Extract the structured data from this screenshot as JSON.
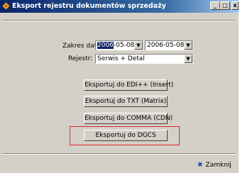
{
  "window": {
    "title": "Eksport rejestru dokumentów sprzedaży"
  },
  "titlebar_buttons": {
    "minimize": "_",
    "maximize": "□",
    "close": "x"
  },
  "form": {
    "date_range_label": "Zakres dat:",
    "date_from": {
      "selected": "2006",
      "rest": "-05-08"
    },
    "date_to": "2006-05-08",
    "register_label": "Rejestr:",
    "register_value": "Serwis + Detal"
  },
  "dropdown_arrow": "▼",
  "buttons": {
    "edi": "Eksportuj do EDI++ (Insert)",
    "txt": "Eksportuj do TXT (Matrix)",
    "comma": "Eksportuj do COMMA (CDN)",
    "dgcs": "Eksportuj do DGCS"
  },
  "footer": {
    "close_icon": "✖",
    "close_label": "Zamknij"
  },
  "colors": {
    "highlight": "#e0282c",
    "face": "#d4d0c8",
    "title_gradient_start": "#0a246a"
  }
}
